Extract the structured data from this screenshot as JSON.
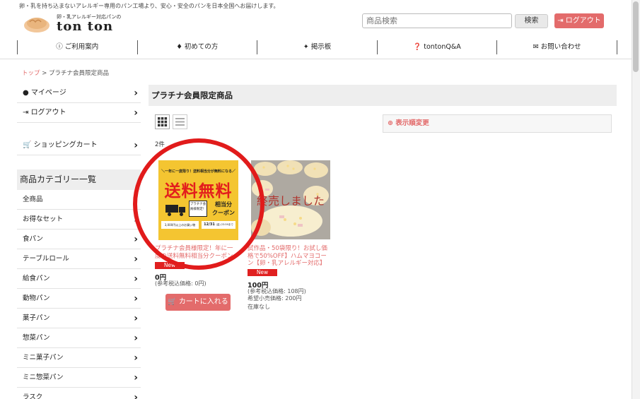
{
  "header": {
    "tagline": "卵・乳を持ち込まないアレルギー専用のパン工場より、安心・安全のパンを日本全国へお届けします。",
    "logo_sub": "卵・乳アレルギー対応パンの",
    "logo_main": "ton ton",
    "search_placeholder": "商品検索",
    "search_label": "検索",
    "logout_label": "ログアウト"
  },
  "nav": [
    {
      "label": "ご利用案内",
      "icon": "info-icon"
    },
    {
      "label": "初めての方",
      "icon": "beginner-icon"
    },
    {
      "label": "掲示板",
      "icon": "pin-icon"
    },
    {
      "label": "tontonQ&A",
      "icon": "question-icon"
    },
    {
      "label": "お問い合わせ",
      "icon": "mail-icon"
    }
  ],
  "breadcrumb": {
    "home": "トップ",
    "current": "プラチナ会員限定商品"
  },
  "sidebar": {
    "links": [
      {
        "label": "マイページ",
        "icon": "user-icon"
      },
      {
        "label": "ログアウト",
        "icon": "logout-icon"
      },
      {
        "label": "ショッピングカート",
        "icon": "cart-icon"
      }
    ],
    "category_header": "商品カテゴリー一覧",
    "categories": [
      "全商品",
      "お得なセット",
      "食パン",
      "テーブルロール",
      "給食パン",
      "動物パン",
      "菓子パン",
      "惣菜パン",
      "ミニ菓子パン",
      "ミニ惣菜パン",
      "ラスク"
    ]
  },
  "main": {
    "title": "プラチナ会員限定商品",
    "sort_label": "表示順変更",
    "count": "2件"
  },
  "products": [
    {
      "title": "プラチナ会員様限定！年に一度の送料無料相当分クーポン",
      "badge": "New",
      "price": "0円",
      "ref_price": "(参考税込価格: 0円)",
      "cart_label": "カートに入れる",
      "image_text": {
        "banner": "＼一年に一度限り！送料相当分が無料になる／",
        "headline": "送料無料",
        "platinum": "プラチナ会員様限定！",
        "amount": "相当分",
        "coupon": "クーポン",
        "condition": "3,000円以上のお買い物",
        "deadline": "12/31",
        "deadline_note": "(金) 23:59まで"
      }
    },
    {
      "title": "試作品・50袋限り！お試し価格で50%OFF】ハムマヨコーン【卵・乳アレルギー対応】",
      "badge": "New",
      "price": "100円",
      "ref_price": "(参考税込価格: 108円)",
      "retail_price": "希望小売価格: 200円",
      "stock": "在庫なし",
      "soldout_overlay": "終売しました"
    }
  ],
  "annotation": {
    "color": "#e11b1b"
  },
  "colors": {
    "accent": "#e36b6b",
    "badge": "#e02020",
    "coupon_bg": "#f4c531"
  }
}
